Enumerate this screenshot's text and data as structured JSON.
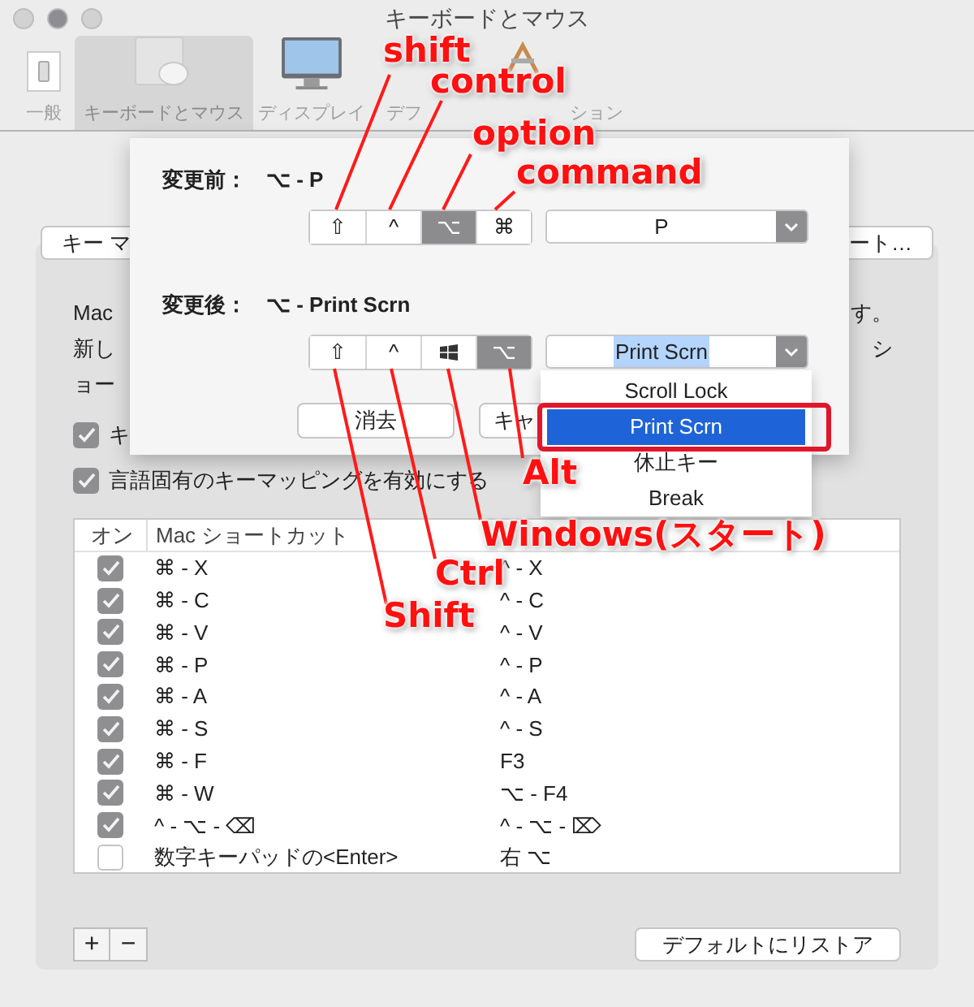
{
  "window": {
    "title": "キーボードとマウス"
  },
  "toolbar": [
    {
      "label": "一般",
      "kind": "switch",
      "selected": false
    },
    {
      "label": "キーボードとマウス",
      "kind": "mouse",
      "selected": true
    },
    {
      "label": "ディスプレイ",
      "kind": "display",
      "selected": false
    },
    {
      "label": "デフ",
      "kind": "none",
      "selected": false
    },
    {
      "label": "ション",
      "kind": "tools",
      "selected": false
    }
  ],
  "background_buttons": [
    "キー マ",
    "ート…"
  ],
  "description": {
    "left_lines": [
      "Mac",
      "新し",
      "ョー"
    ],
    "right_lines": [
      "す。",
      "シ"
    ]
  },
  "checkboxes": [
    {
      "label": "キ",
      "checked": true
    },
    {
      "label": "言語固有のキーマッピングを有効にする",
      "checked": true
    }
  ],
  "sheet": {
    "sections": [
      {
        "label": "変更前：",
        "shortcut": "⌥ - P",
        "key": "P",
        "key_highlighted": false,
        "modifiers": [
          {
            "kind": "symbol",
            "symbol": "⇧",
            "selected": false
          },
          {
            "kind": "symbol",
            "symbol": "^",
            "selected": false
          },
          {
            "kind": "symbol",
            "symbol": "⌥",
            "selected": true
          },
          {
            "kind": "symbol",
            "symbol": "⌘",
            "selected": false
          }
        ]
      },
      {
        "label": "変更後：",
        "shortcut": "⌥ - Print Scrn",
        "key": "Print Scrn",
        "key_highlighted": true,
        "modifiers": [
          {
            "kind": "symbol",
            "symbol": "⇧",
            "selected": false
          },
          {
            "kind": "symbol",
            "symbol": "^",
            "selected": false
          },
          {
            "kind": "windows",
            "selected": false
          },
          {
            "kind": "symbol",
            "symbol": "⌥",
            "selected": true
          }
        ]
      }
    ],
    "buttons": [
      "消去",
      "キャ"
    ]
  },
  "menu": [
    {
      "label": "Scroll Lock",
      "selected": false
    },
    {
      "label": "Print Scrn",
      "selected": true
    },
    {
      "label": "休止キー",
      "selected": false
    },
    {
      "label": "Break",
      "selected": false
    }
  ],
  "table": {
    "columns": [
      "オン",
      "Mac ショートカット"
    ],
    "rows": [
      {
        "checked": true,
        "mac": "⌘ - X",
        "pc": "^ - X"
      },
      {
        "checked": true,
        "mac": "⌘ - C",
        "pc": "^ - C"
      },
      {
        "checked": true,
        "mac": "⌘ - V",
        "pc": "^ - V"
      },
      {
        "checked": true,
        "mac": "⌘ - P",
        "pc": "^ - P"
      },
      {
        "checked": true,
        "mac": "⌘ - A",
        "pc": "^ - A"
      },
      {
        "checked": true,
        "mac": "⌘ - S",
        "pc": "^ - S"
      },
      {
        "checked": true,
        "mac": "⌘ - F",
        "pc": "F3"
      },
      {
        "checked": true,
        "mac": "⌘ - W",
        "pc": "⌥ - F4"
      },
      {
        "checked": true,
        "mac": "^ - ⌥ - ⌫",
        "pc": "^ - ⌥ - ⌦"
      },
      {
        "checked": false,
        "mac": "数字キーパッドの<Enter>",
        "pc": "右 ⌥"
      }
    ]
  },
  "footer": {
    "add": "+",
    "remove": "−",
    "restore": "デフォルトにリストア"
  },
  "annotations": [
    "shift",
    "control",
    "option",
    "command",
    "Alt",
    "Windows(スタート)",
    "Ctrl",
    "Shift"
  ]
}
